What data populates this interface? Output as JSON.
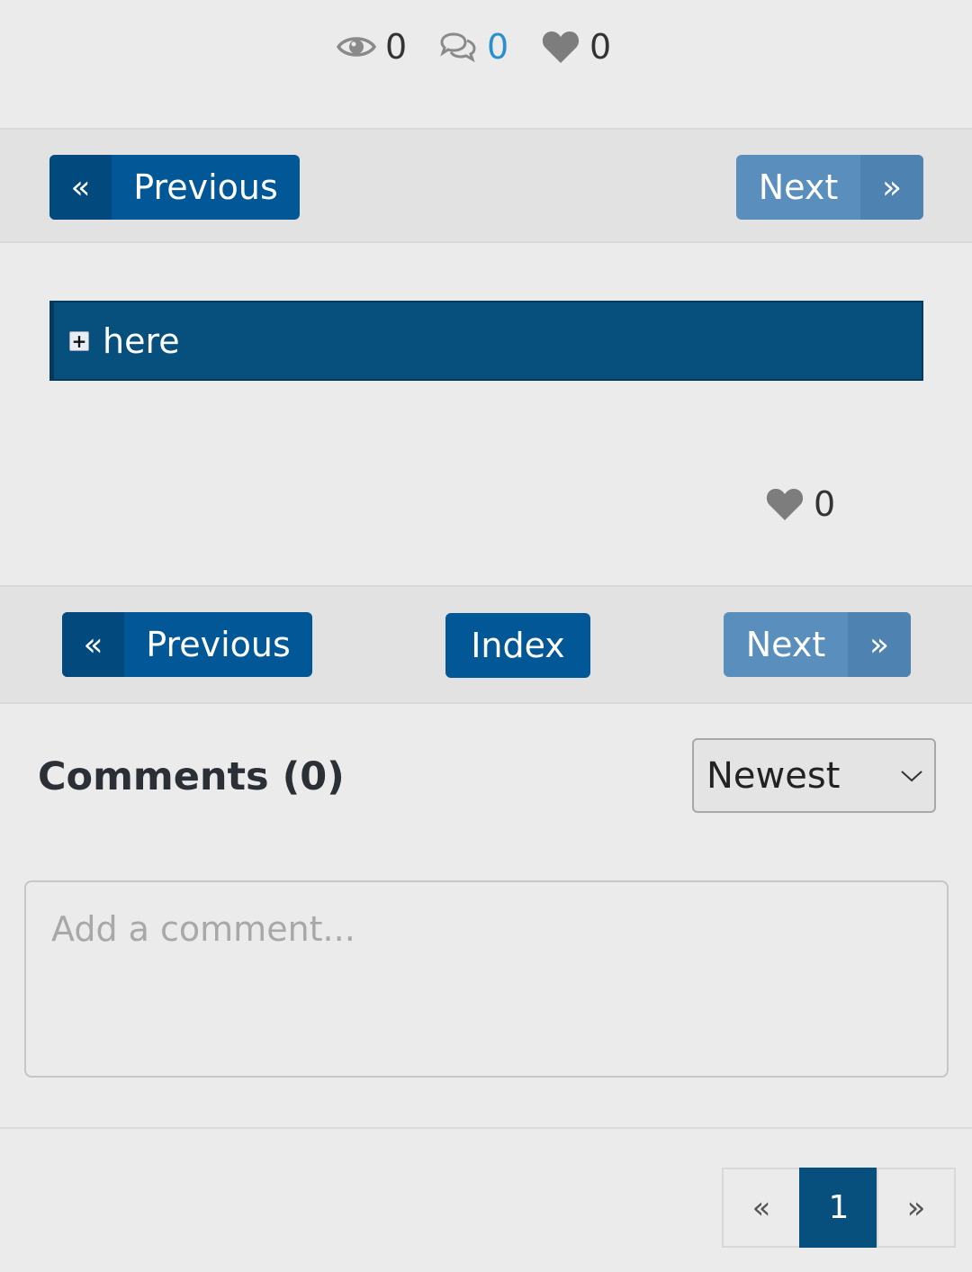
{
  "stats": {
    "views": "0",
    "comments": "0",
    "likes": "0"
  },
  "nav": {
    "previous_label": "Previous",
    "next_label": "Next",
    "index_label": "Index",
    "prev_arrow": "«",
    "next_arrow": "»"
  },
  "spoiler": {
    "label": "here"
  },
  "post_likes": "0",
  "comments": {
    "title": "Comments (0)",
    "sort_selected": "Newest",
    "placeholder": "Add a comment..."
  },
  "pagination": {
    "prev": "«",
    "current": "1",
    "next": "»"
  },
  "colors": {
    "primary": "#025896",
    "primary_dark": "#024a7d",
    "next_bg": "#5a8fbd",
    "link": "#2a8fce"
  }
}
